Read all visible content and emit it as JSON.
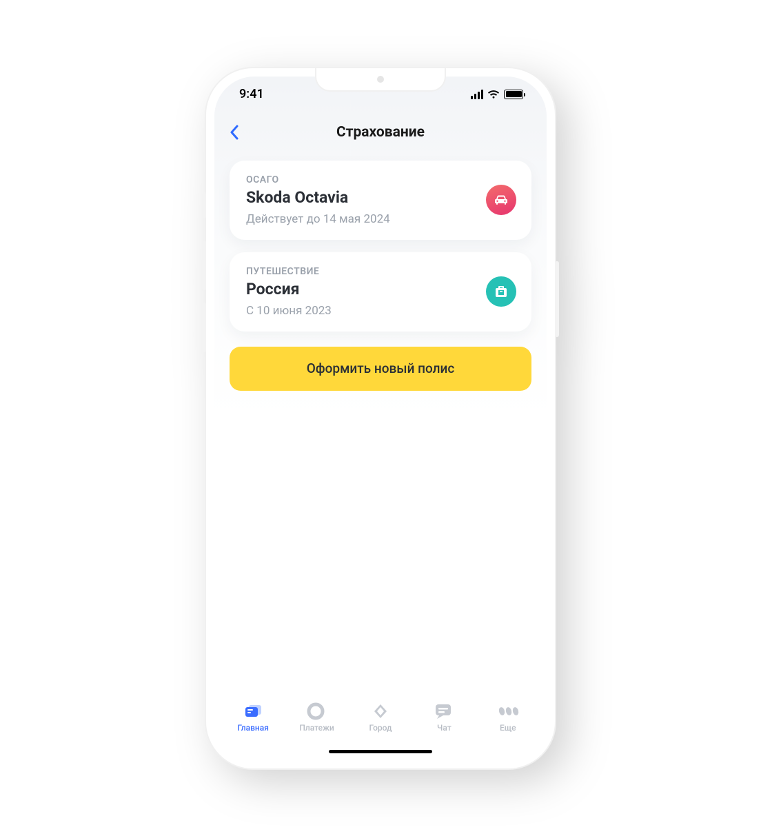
{
  "statusbar": {
    "time": "9:41"
  },
  "nav": {
    "title": "Страхование"
  },
  "policies": [
    {
      "type": "ОСАГО",
      "title": "Skoda Octavia",
      "subtitle": "Действует до 14 мая 2024",
      "icon": "car-icon",
      "badgeClass": "badge-car"
    },
    {
      "type": "ПУТЕШЕСТВИЕ",
      "title": "Россия",
      "subtitle": "С 10 июня 2023",
      "icon": "suitcase-icon",
      "badgeClass": "badge-travel"
    }
  ],
  "cta": {
    "label": "Оформить новый полис"
  },
  "tabs": [
    {
      "label": "Главная",
      "icon": "home-icon",
      "active": true
    },
    {
      "label": "Платежи",
      "icon": "payments-icon",
      "active": false
    },
    {
      "label": "Город",
      "icon": "city-icon",
      "active": false
    },
    {
      "label": "Чат",
      "icon": "chat-icon",
      "active": false
    },
    {
      "label": "Еще",
      "icon": "more-icon",
      "active": false
    }
  ],
  "colors": {
    "accent": "#3a6cff",
    "cta": "#ffd83a",
    "muted": "#9aa1ab"
  }
}
